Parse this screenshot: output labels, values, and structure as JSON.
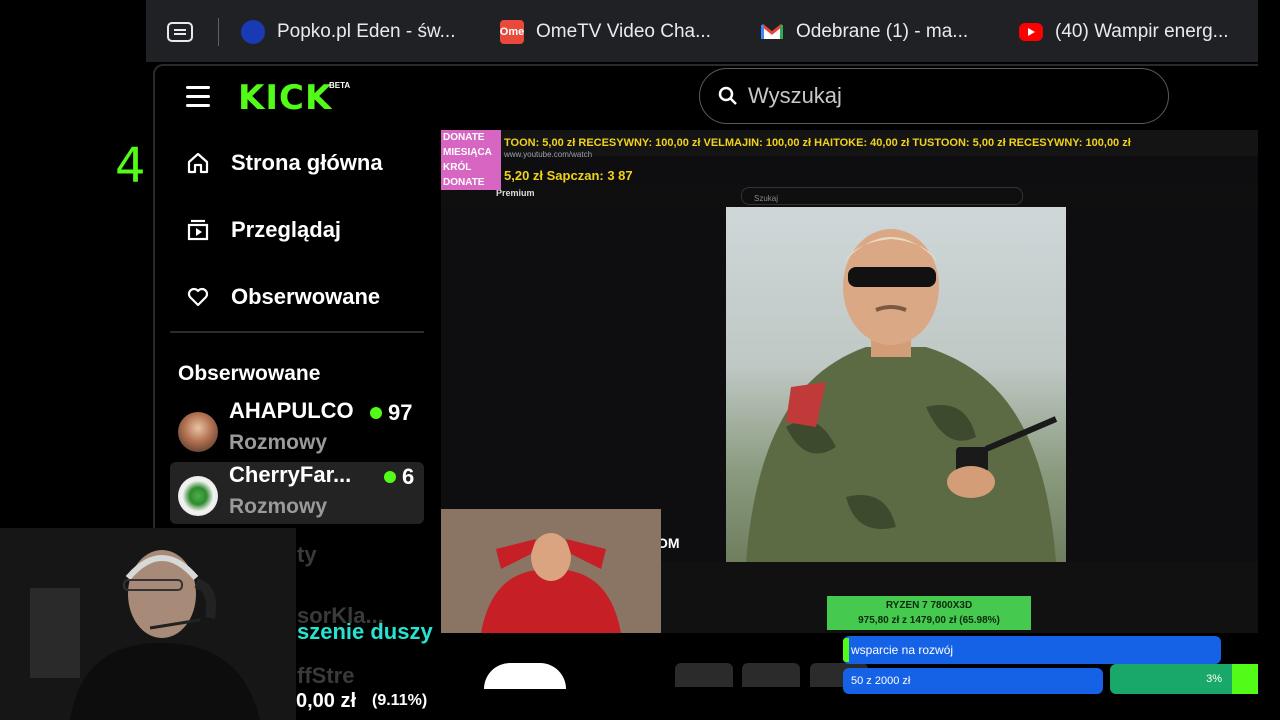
{
  "browser": {
    "bookmarks": [
      {
        "label": "Popko.pl Eden - św...",
        "icon": "popko-icon",
        "color": "#1a3ab5"
      },
      {
        "label": "OmeTV Video Cha...",
        "icon": "ometv-icon",
        "color": "#e8493a"
      },
      {
        "label": "Odebrane (1) - ma...",
        "icon": "gmail-icon",
        "color": "#ea4335"
      },
      {
        "label": "(40) Wampir energ...",
        "icon": "youtube-icon",
        "color": "#ff0000"
      }
    ]
  },
  "kick": {
    "logo": "KICK",
    "logo_badge": "BETA",
    "accent": "#53fc18",
    "search_placeholder": "Wyszukaj",
    "nav": [
      {
        "label": "Strona główna",
        "icon": "home-icon"
      },
      {
        "label": "Przeglądaj",
        "icon": "browse-icon"
      },
      {
        "label": "Obserwowane",
        "icon": "heart-icon"
      }
    ],
    "followed_title": "Obserwowane",
    "channels": [
      {
        "name": "AHAPULCO",
        "viewers": "97",
        "category": "Rozmowy"
      },
      {
        "name": "CherryFar...",
        "viewers": "6",
        "category": "Rozmowy"
      }
    ],
    "ghost_channels": [
      "ty",
      "sorKla...",
      "ffStre"
    ]
  },
  "left_margin_number": "4",
  "stream": {
    "ticker": "TOON: 5,00 zł RECESYWNY: 100,00 zł VELMAJIN: 100,00 zł HAITOKE: 40,00 zł TUSTOON: 5,00 zł RECESYWNY: 100,00 zł",
    "donate_box": [
      "DONATE",
      "MIESIĄCA",
      "KRÓL",
      "DONATE"
    ],
    "donate_line": "5,20 zł Sapczan: 3 87",
    "url": "www.youtube.com/watch",
    "premium": "Premium",
    "yt_search": "Szukaj",
    "ryzen_title": "RYZEN 7 7800X3D",
    "ryzen_progress": "975,80 zł z 1479,00 zł (65.98%)",
    "overlay_partial": "OM"
  },
  "overlay": {
    "soul_text": "szenie duszy",
    "bottom_amount": "0,00 zł",
    "bottom_pct": "(9.11%)",
    "dev_bar": "wsparcie na rozwój",
    "pill_50": "50 z  2000  zł",
    "pill_3": "3%"
  }
}
